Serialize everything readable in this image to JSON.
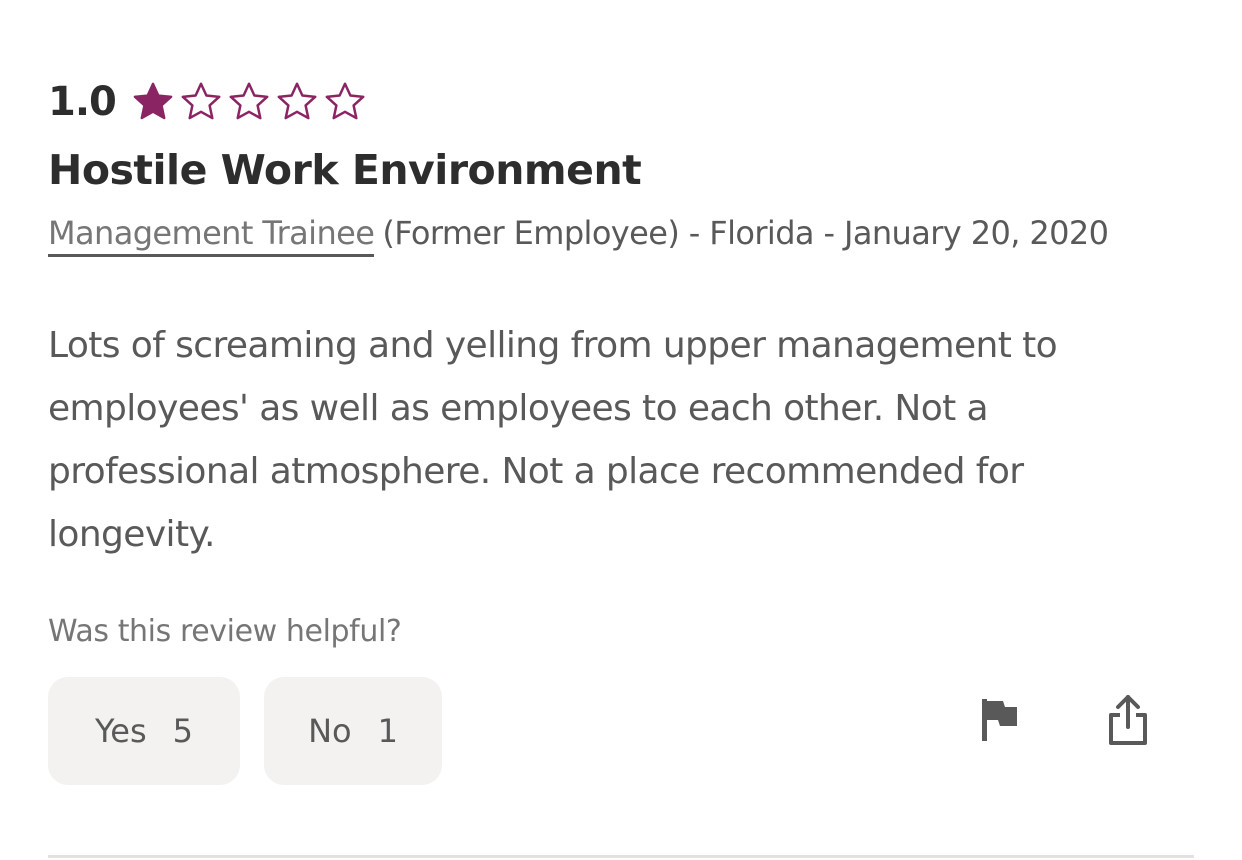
{
  "review": {
    "rating_value": "1.0",
    "rating_stars": 1,
    "star_max": 5,
    "title": "Hostile Work Environment",
    "job_title": "Management Trainee",
    "meta_rest": "(Former Employee) - Florida - January 20, 2020",
    "text": "Lots of screaming and yelling from upper management to employees' as well as employees to each other. Not a professional atmosphere. Not a place recommended for longevity."
  },
  "helpful": {
    "question": "Was this review helpful?",
    "yes_label": "Yes",
    "yes_count": "5",
    "no_label": "No",
    "no_count": "1"
  },
  "icons": {
    "flag": "flag-icon",
    "share": "share-icon",
    "star_filled": "star-filled-icon",
    "star_empty": "star-outline-icon"
  },
  "colors": {
    "star": "#8b2463",
    "text_dark": "#2d2d2d",
    "text_muted": "#595959",
    "button_bg": "#f3f2f1"
  }
}
